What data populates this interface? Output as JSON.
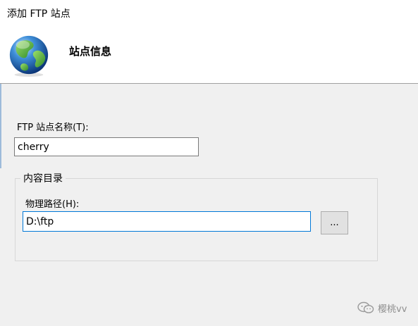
{
  "window": {
    "title": "添加 FTP 站点"
  },
  "header": {
    "title": "站点信息",
    "icon": "globe-icon"
  },
  "form": {
    "site_name_label": "FTP 站点名称(T):",
    "site_name_value": "cherry",
    "content_directory": {
      "title": "内容目录",
      "physical_path_label": "物理路径(H):",
      "physical_path_value": "D:\\ftp",
      "browse_label": "..."
    }
  },
  "watermark": {
    "text": "樱桃vv",
    "icon": "wechat-icon"
  },
  "colors": {
    "header_bg": "#ffffff",
    "body_bg": "#f0f0f0",
    "focus_border": "#0078d7",
    "button_bg": "#e1e1e1"
  }
}
